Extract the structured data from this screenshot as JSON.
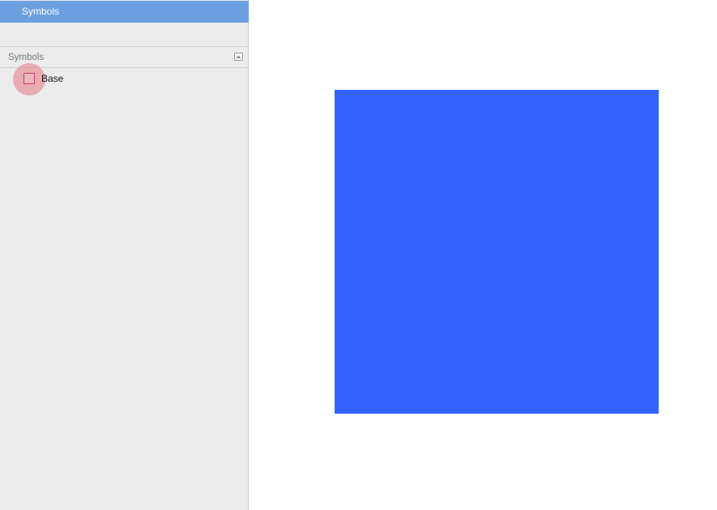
{
  "sidebar": {
    "page_label": "Symbols",
    "section_title": "Symbols",
    "collapse_icon": "collapse-section-icon",
    "layers": [
      {
        "label": "Base",
        "icon": "symbol-icon"
      }
    ]
  },
  "canvas": {
    "artboard_color": "#3362ff",
    "background": "#ffffff"
  },
  "colors": {
    "selection": "#6c9fe0",
    "sidebar_bg": "#ececec",
    "symbol_accent": "#c0416a"
  }
}
